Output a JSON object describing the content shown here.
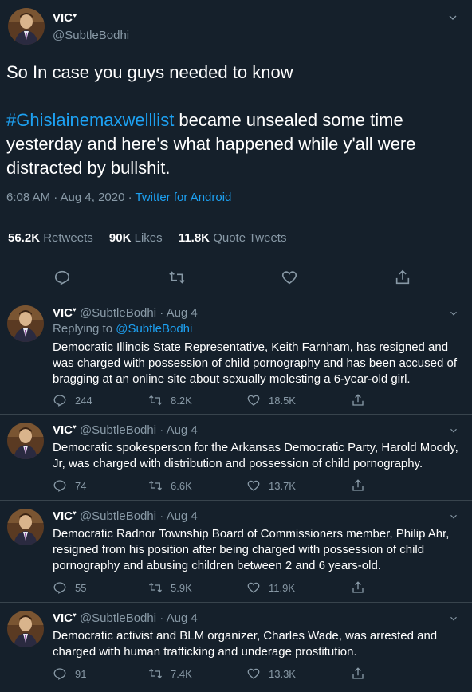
{
  "main_tweet": {
    "name": "VIC",
    "handle": "@SubtleBodhi",
    "text_line1": "So In case you guys needed to know",
    "hashtag": "#Ghislainemaxwelllist",
    "text_rest": " became unsealed some time yesterday and here's what happened while y'all were distracted by bullshit.",
    "timestamp": "6:08 AM · Aug 4, 2020 · ",
    "source": "Twitter for Android",
    "retweets_count": "56.2K",
    "retweets_label": "Retweets",
    "likes_count": "90K",
    "likes_label": "Likes",
    "quotes_count": "11.8K",
    "quotes_label": "Quote Tweets"
  },
  "colors": {
    "background": "#15202b",
    "divider": "#38444d",
    "muted": "#8899a6",
    "accent": "#1da1f2"
  },
  "icons": [
    "reply-icon",
    "retweet-icon",
    "like-icon",
    "share-icon",
    "chevron-down-icon"
  ],
  "replies": [
    {
      "name": "VIC",
      "handle_date": "@SubtleBodhi · Aug 4",
      "replying_prefix": "Replying to ",
      "replying_handle": "@SubtleBodhi",
      "text": "Democratic Illinois State Representative, Keith Farnham, has resigned and was charged with possession of child pornography and has been accused of bragging at an online site about sexually molesting a 6-year-old girl.",
      "replies": "244",
      "retweets": "8.2K",
      "likes": "18.5K"
    },
    {
      "name": "VIC",
      "handle_date": "@SubtleBodhi · Aug 4",
      "text": "Democratic spokesperson for the Arkansas Democratic Party, Harold Moody, Jr, was charged with distribution and possession of child pornography.",
      "replies": "74",
      "retweets": "6.6K",
      "likes": "13.7K"
    },
    {
      "name": "VIC",
      "handle_date": "@SubtleBodhi · Aug 4",
      "text": "Democratic Radnor Township Board of Commissioners member, Philip Ahr, resigned from his position after being charged with possession of child pornography and abusing children between 2 and 6 years-old.",
      "replies": "55",
      "retweets": "5.9K",
      "likes": "11.9K"
    },
    {
      "name": "VIC",
      "handle_date": "@SubtleBodhi · Aug 4",
      "text": "Democratic activist and BLM organizer, Charles Wade, was arrested and charged with human trafficking and underage prostitution.",
      "replies": "91",
      "retweets": "7.4K",
      "likes": "13.3K"
    }
  ]
}
